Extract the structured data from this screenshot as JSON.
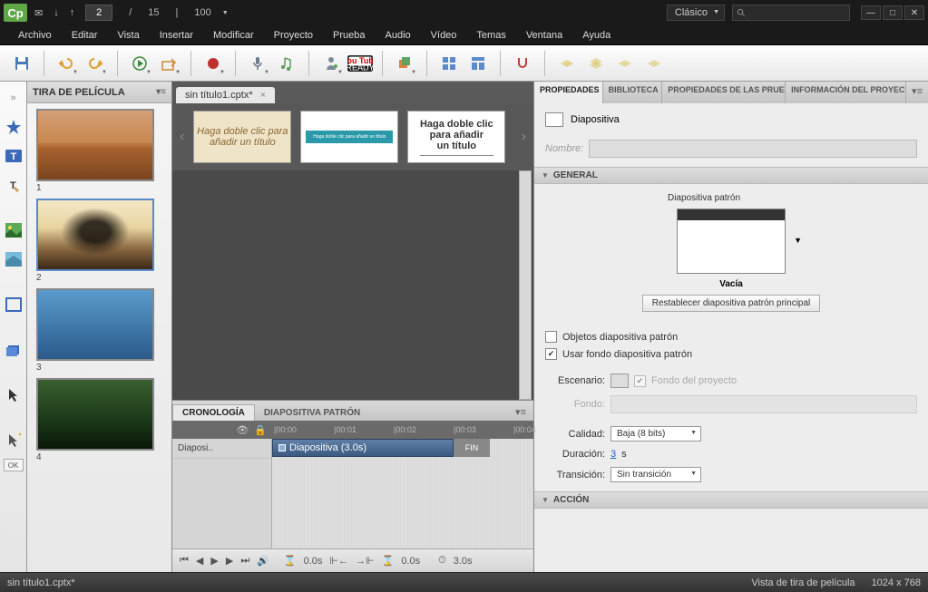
{
  "app": {
    "logo": "Cp"
  },
  "titlebar": {
    "current_page": "2",
    "total_pages": "15",
    "zoom": "100",
    "workspace": "Clásico"
  },
  "menu": [
    "Archivo",
    "Editar",
    "Vista",
    "Insertar",
    "Modificar",
    "Proyecto",
    "Prueba",
    "Audio",
    "Vídeo",
    "Temas",
    "Ventana",
    "Ayuda"
  ],
  "filmstrip": {
    "title": "TIRA DE PELÍCULA",
    "slides": [
      {
        "num": "1"
      },
      {
        "num": "2"
      },
      {
        "num": "3"
      },
      {
        "num": "4"
      }
    ]
  },
  "doc_tab": "sin título1.cptx*",
  "themes": {
    "t1_line1": "Haga doble clic para",
    "t1_line2": "añadir un título",
    "t2_line1": "Haga doble clic para añadir un título",
    "t3_line1": "Haga doble clic para añadir",
    "t3_line2": "un título"
  },
  "timeline": {
    "tab1": "CRONOLOGÍA",
    "tab2": "DIAPOSITIVA PATRÓN",
    "ticks": [
      "|00:00",
      "|00:01",
      "|00:02",
      "|00:03",
      "|00:04"
    ],
    "track_label": "Diaposi..",
    "clip_label": "Diapositiva (3.0s)",
    "end_label": "FIN",
    "time1": "0.0s",
    "time2": "0.0s",
    "time3": "3.0s"
  },
  "props": {
    "tabs": [
      "PROPIEDADES",
      "BIBLIOTECA",
      "PROPIEDADES DE LAS PRUE",
      "INFORMACIÓN DEL PROYEC"
    ],
    "slide_label": "Diapositiva",
    "name_label": "Nombre:",
    "section_general": "GENERAL",
    "master_slide_label": "Diapositiva patrón",
    "master_name": "Vacía",
    "reset_btn": "Restablecer diapositiva patrón principal",
    "chk_objects": "Objetos diapositiva patrón",
    "chk_bg": "Usar fondo diapositiva patrón",
    "stage_label": "Escenario:",
    "proj_bg_label": "Fondo del proyecto",
    "bg_label": "Fondo:",
    "quality_label": "Calidad:",
    "quality_value": "Baja (8 bits)",
    "duration_label": "Duración:",
    "duration_value": "3",
    "duration_unit": "s",
    "transition_label": "Transición:",
    "transition_value": "Sin transición",
    "section_action": "ACCIÓN"
  },
  "statusbar": {
    "file": "sin título1.cptx*",
    "view": "Vista de tira de película",
    "dims": "1024 x 768"
  }
}
